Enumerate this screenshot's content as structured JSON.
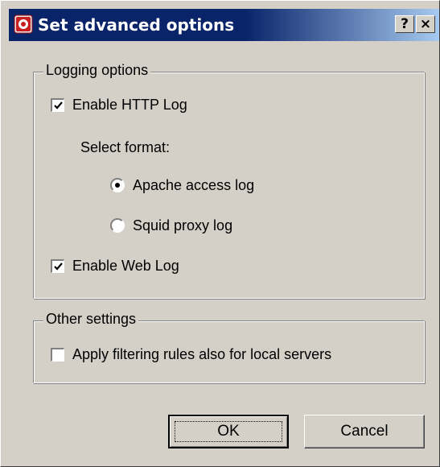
{
  "window": {
    "title": "Set advanced options",
    "help_label": "?",
    "close_label": "×"
  },
  "logging": {
    "group_label": "Logging options",
    "enable_http_log": {
      "label": "Enable HTTP Log",
      "checked": true
    },
    "select_format_label": "Select format:",
    "formats": [
      {
        "label": "Apache access log",
        "selected": true
      },
      {
        "label": "Squid proxy log",
        "selected": false
      }
    ],
    "enable_web_log": {
      "label": "Enable Web Log",
      "checked": true
    }
  },
  "other": {
    "group_label": "Other settings",
    "apply_filtering": {
      "label": "Apply filtering rules also for local servers",
      "checked": false
    }
  },
  "buttons": {
    "ok_label": "OK",
    "cancel_label": "Cancel"
  },
  "colors": {
    "titlebar_start": "#0a246a",
    "titlebar_end": "#a6caf0",
    "face": "#d4d0c8"
  }
}
